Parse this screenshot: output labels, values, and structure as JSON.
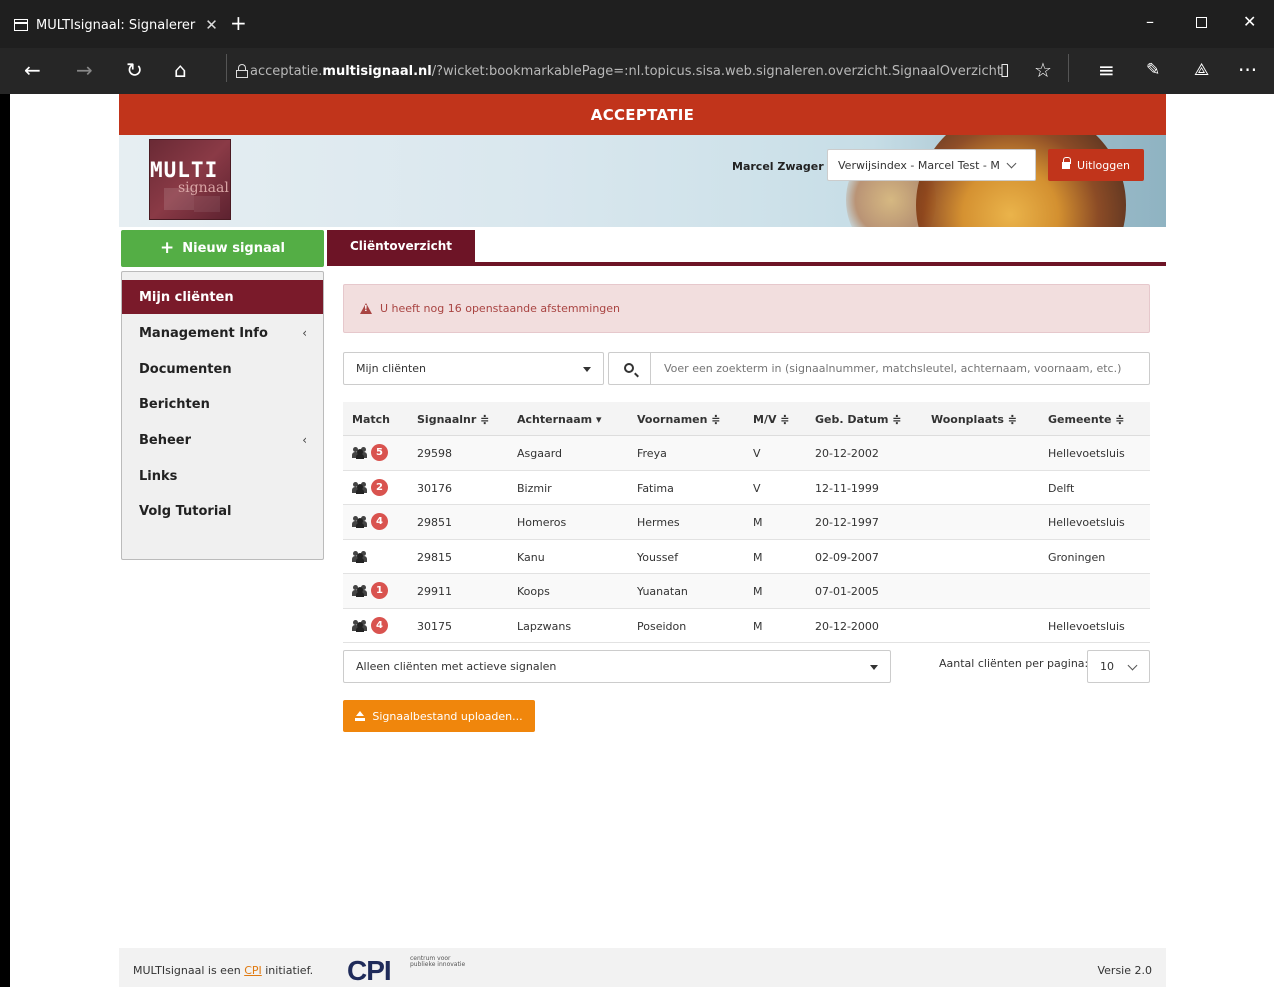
{
  "browser": {
    "tab_title": "MULTIsignaal: Signalerer",
    "new_tab": "+",
    "url_prefix": "acceptatie.",
    "url_domain": "multisignaal.nl",
    "url_path": "/?wicket:bookmarkablePage=:nl.topicus.sisa.web.signaleren.overzicht.SignaalOverzicht"
  },
  "banner": {
    "label": "ACCEPTATIE"
  },
  "header": {
    "logo_multi": "MULTI",
    "logo_sig": "signaal",
    "user_name": "Marcel Zwager",
    "org_selected": "Verwijsindex - Marcel Test - M",
    "logout_label": "Uitloggen",
    "colors": {
      "accent": "#c1341b",
      "brand": "#6d1426"
    }
  },
  "sidebar": {
    "new_signal_label": "Nieuw signaal",
    "items": [
      {
        "label": "Mijn cliënten",
        "active": true,
        "submenu": false
      },
      {
        "label": "Management Info",
        "active": false,
        "submenu": true
      },
      {
        "label": "Documenten",
        "active": false,
        "submenu": false
      },
      {
        "label": "Berichten",
        "active": false,
        "submenu": false
      },
      {
        "label": "Beheer",
        "active": false,
        "submenu": true
      },
      {
        "label": "Links",
        "active": false,
        "submenu": false
      },
      {
        "label": "Volg Tutorial",
        "active": false,
        "submenu": false
      }
    ],
    "caret": "‹"
  },
  "main": {
    "tab_label": "Cliëntoverzicht",
    "alert_text": "U heeft nog 16 openstaande afstemmingen",
    "filter_selected": "Mijn cliënten",
    "search_placeholder": "Voer een zoekterm in (signaalnummer, matchsleutel, achternaam, voornaam, etc.)",
    "table": {
      "headers": [
        "Match",
        "Signaalnr ≑",
        "Achternaam ▾",
        "Voornamen ≑",
        "M/V ≑",
        "Geb. Datum ≑",
        "Woonplaats ≑",
        "Gemeente ≑"
      ],
      "rows": [
        {
          "badge": "5",
          "signaalnr": "29598",
          "achternaam": "Asgaard",
          "voornamen": "Freya",
          "mv": "V",
          "geb": "20-12-2002",
          "woonplaats": "",
          "gemeente": "Hellevoetsluis"
        },
        {
          "badge": "2",
          "signaalnr": "30176",
          "achternaam": "Bizmir",
          "voornamen": "Fatima",
          "mv": "V",
          "geb": "12-11-1999",
          "woonplaats": "",
          "gemeente": "Delft"
        },
        {
          "badge": "4",
          "signaalnr": "29851",
          "achternaam": "Homeros",
          "voornamen": "Hermes",
          "mv": "M",
          "geb": "20-12-1997",
          "woonplaats": "",
          "gemeente": "Hellevoetsluis"
        },
        {
          "badge": "",
          "signaalnr": "29815",
          "achternaam": "Kanu",
          "voornamen": "Youssef",
          "mv": "M",
          "geb": "02-09-2007",
          "woonplaats": "",
          "gemeente": "Groningen"
        },
        {
          "badge": "1",
          "signaalnr": "29911",
          "achternaam": "Koops",
          "voornamen": "Yuanatan",
          "mv": "M",
          "geb": "07-01-2005",
          "woonplaats": "",
          "gemeente": ""
        },
        {
          "badge": "4",
          "signaalnr": "30175",
          "achternaam": "Lapzwans",
          "voornamen": "Poseidon",
          "mv": "M",
          "geb": "20-12-2000",
          "woonplaats": "",
          "gemeente": "Hellevoetsluis"
        }
      ]
    },
    "bottom_filter": "Alleen cliënten met actieve signalen",
    "per_page_label": "Aantal cliënten per pagina:",
    "per_page_value": "10",
    "upload_label": "Signaalbestand uploaden..."
  },
  "footer": {
    "text_before": "MULTIsignaal is een ",
    "link": "CPI",
    "text_after": " initiatief.",
    "cpi_logo": "CPI",
    "cpi_sub": "centrum voor publieke innovatie",
    "version": "Versie 2.0"
  }
}
